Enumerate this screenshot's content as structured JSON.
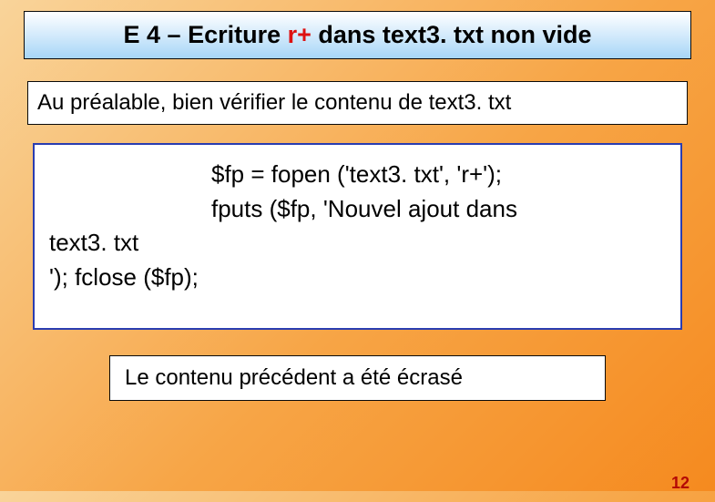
{
  "title": {
    "prefix": "E 4 – Ecriture ",
    "mode": "r+",
    "suffix": " dans text3. txt non vide"
  },
  "subtitle": "Au préalable, bien vérifier le contenu de text3. txt",
  "code": {
    "line1": "$fp = fopen ('text3. txt', 'r+');",
    "line2": "fputs ($fp, 'Nouvel ajout dans",
    "line3": "text3. txt",
    "line4": "'); fclose ($fp);"
  },
  "result": "Le contenu précédent a été écrasé",
  "page_number": "12"
}
